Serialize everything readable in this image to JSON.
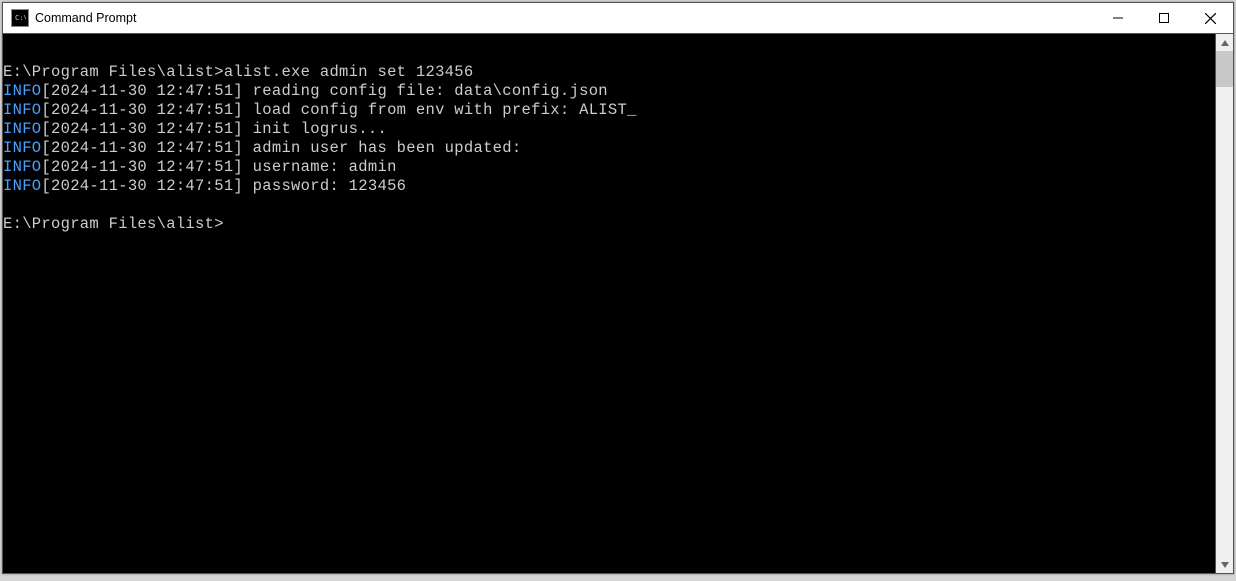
{
  "window": {
    "title": "Command Prompt"
  },
  "terminal": {
    "prompt_path": "E:\\Program Files\\alist>",
    "command": "alist.exe admin set 123456",
    "level_label": "INFO",
    "lines": [
      {
        "ts": "[2024-11-30 12:47:51]",
        "msg": " reading config file: data\\config.json"
      },
      {
        "ts": "[2024-11-30 12:47:51]",
        "msg": " load config from env with prefix: ALIST_"
      },
      {
        "ts": "[2024-11-30 12:47:51]",
        "msg": " init logrus..."
      },
      {
        "ts": "[2024-11-30 12:47:51]",
        "msg": " admin user has been updated:"
      },
      {
        "ts": "[2024-11-30 12:47:51]",
        "msg": " username: admin"
      },
      {
        "ts": "[2024-11-30 12:47:51]",
        "msg": " password: 123456"
      }
    ],
    "next_prompt": "E:\\Program Files\\alist>"
  }
}
